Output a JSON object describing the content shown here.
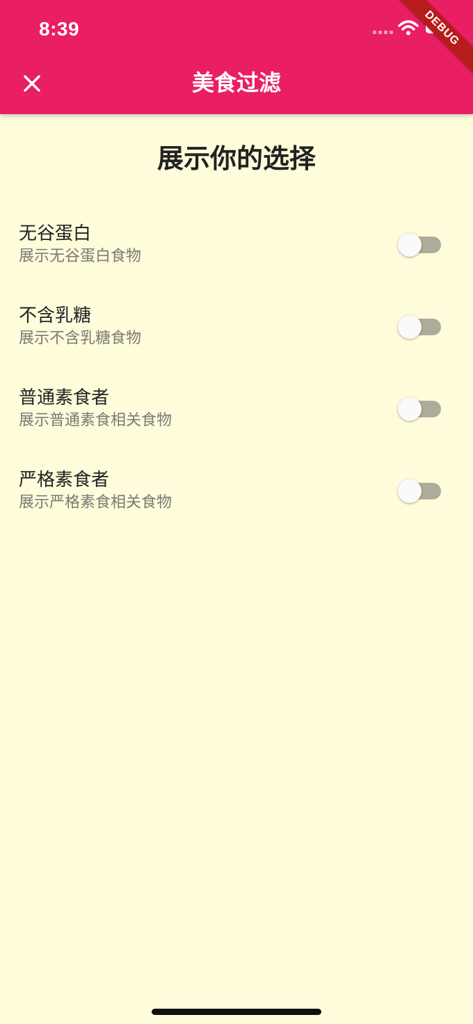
{
  "status_bar": {
    "time": "8:39",
    "icons": [
      "cellular-signal-icon",
      "wifi-icon",
      "battery-icon"
    ]
  },
  "debug_banner": "DEBUG",
  "app_bar": {
    "title": "美食过滤",
    "close_icon": "close-icon",
    "background_color": "#E91E63"
  },
  "heading": "展示你的选择",
  "filters": [
    {
      "title": "无谷蛋白",
      "subtitle": "展示无谷蛋白食物",
      "enabled": false
    },
    {
      "title": "不含乳糖",
      "subtitle": "展示不含乳糖食物",
      "enabled": false
    },
    {
      "title": "普通素食者",
      "subtitle": "展示普通素食相关食物",
      "enabled": false
    },
    {
      "title": "严格素食者",
      "subtitle": "展示严格素食相关食物",
      "enabled": false
    }
  ],
  "colors": {
    "page_background": "#FFFCDC",
    "switch_track_off": "#ADAC9A",
    "switch_thumb_off": "#FAFAFA"
  }
}
